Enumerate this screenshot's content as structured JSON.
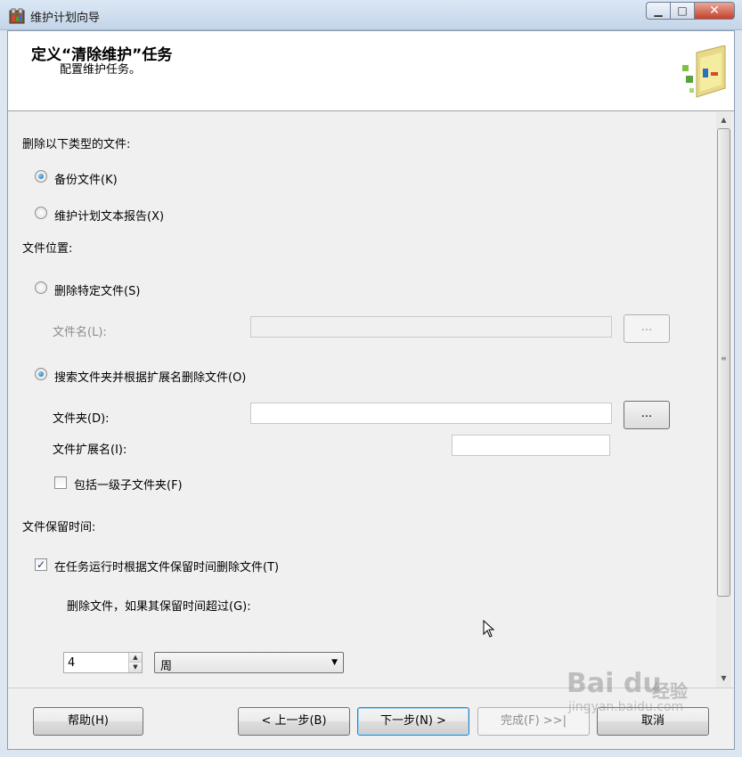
{
  "window": {
    "title": "维护计划向导",
    "minimize_glyph": "▁",
    "maximize_glyph": "□",
    "close_glyph": "✕"
  },
  "header": {
    "title": "定义“清除维护”任务",
    "subtitle": "配置维护任务。"
  },
  "file_types": {
    "label": "删除以下类型的文件:",
    "backup_files": {
      "label": "备份文件(K)",
      "selected": true
    },
    "report_files": {
      "label": "维护计划文本报告(X)",
      "selected": false
    }
  },
  "file_location": {
    "label": "文件位置:",
    "specific_file": {
      "label": "删除特定文件(S)",
      "selected": false,
      "filename_label": "文件名(L):",
      "filename_value": "",
      "browse_label": "..."
    },
    "search_folder": {
      "label": "搜索文件夹并根据扩展名删除文件(O)",
      "selected": true,
      "folder_label": "文件夹(D):",
      "folder_value": "",
      "browse_label": "...",
      "extension_label": "文件扩展名(I):",
      "extension_value": "",
      "subfolders_label": "包括一级子文件夹(F)",
      "subfolders_checked": false
    }
  },
  "file_age": {
    "label": "文件保留时间:",
    "delete_by_age_label": "在任务运行时根据文件保留时间删除文件(T)",
    "delete_by_age_checked": true,
    "older_than_label": "删除文件，如果其保留时间超过(G):",
    "age_value": "4",
    "age_unit": "周"
  },
  "buttons": {
    "help": "帮助(H)",
    "back": "< 上一步(B)",
    "next": "下一步(N) >",
    "finish": "完成(F) >>|",
    "cancel": "取消"
  },
  "icons": {
    "app": "maintenance-plan-icon",
    "wizard_art": "wizard-banner-icon",
    "check": "✓",
    "spin_up": "▲",
    "spin_down": "▼",
    "dropdown": "▼",
    "scroll_up": "▲",
    "scroll_down": "▼",
    "grip": "≡"
  },
  "watermark": {
    "brand": "Bai du",
    "brand_cn": "经验",
    "url": "jingyan.baidu.com"
  },
  "colors": {
    "accent": "#3c7fb1",
    "title_bar": "#c4d5e9",
    "close_button": "#c4412c",
    "dialog_bg": "#f0f0f0"
  }
}
